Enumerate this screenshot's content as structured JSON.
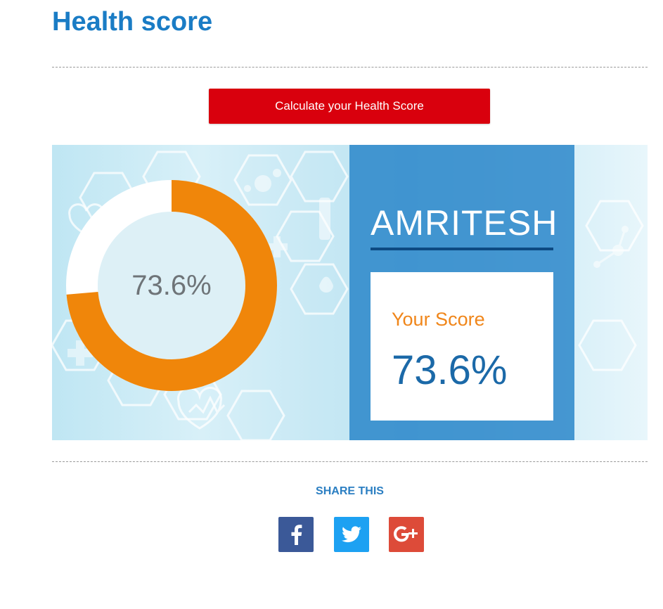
{
  "header": {
    "title": "Health score"
  },
  "actions": {
    "calculate_label": "Calculate your Health Score"
  },
  "result": {
    "donut_percent": 73.6,
    "donut_label": "73.6%",
    "user_name": "AMRITESH",
    "score_caption": "Your Score",
    "score_value": "73.6%"
  },
  "share": {
    "label": "SHARE THIS",
    "buttons": [
      {
        "network": "facebook",
        "icon": "facebook-icon",
        "color": "#3b5998"
      },
      {
        "network": "twitter",
        "icon": "twitter-icon",
        "color": "#1da1f2"
      },
      {
        "network": "google-plus",
        "icon": "google-plus-icon",
        "color": "#dd4b39"
      }
    ]
  },
  "colors": {
    "title": "#1a7cc5",
    "button": "#d9000d",
    "donut_fill": "#f0860a",
    "panel": "#2482c8",
    "score_caption": "#f0861a",
    "score_value": "#1b69a8"
  }
}
